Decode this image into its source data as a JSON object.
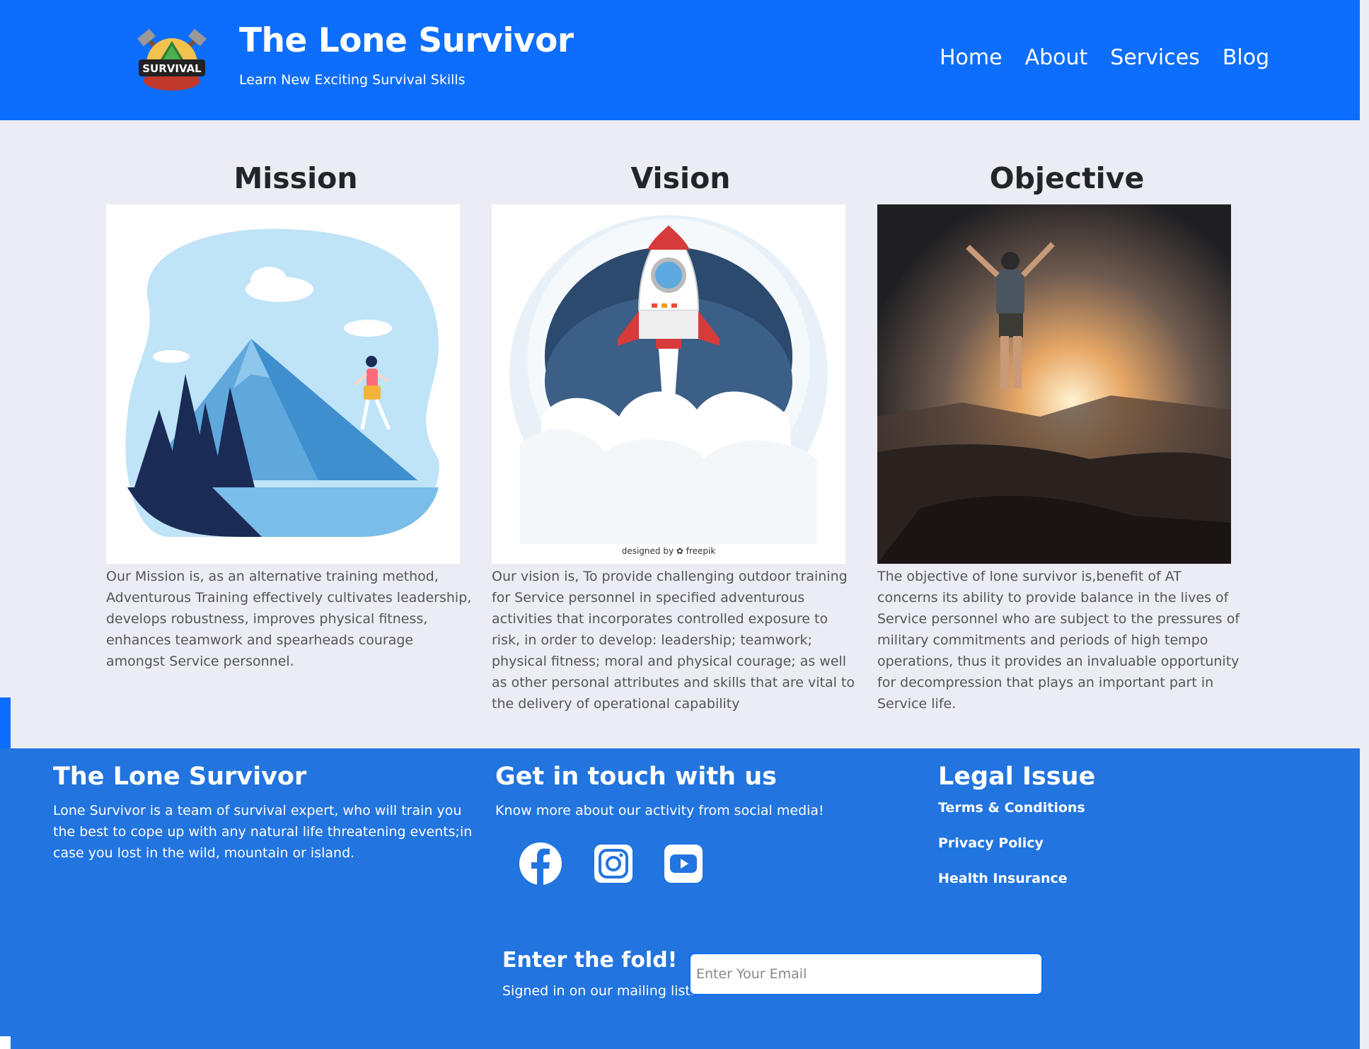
{
  "header": {
    "logo_text": "SURVIVAL",
    "title": "The Lone Survivor",
    "tagline": "Learn New Exciting Survival Skills",
    "nav": [
      "Home",
      "About",
      "Services",
      "Blog"
    ]
  },
  "cards": [
    {
      "title": "Mission",
      "image": "mountain-runner-illustration",
      "text": "Our Mission is, as an alternative training method, Adventurous Training effectively cultivates leadership, develops robustness, improves physical fitness, enhances teamwork and spearheads courage amongst Service personnel."
    },
    {
      "title": "Vision",
      "image": "rocket-launch-illustration",
      "image_credit": "designed by ✿ freepik",
      "text": "Our vision is, To provide challenging outdoor training for Service personnel in specified adventurous activities that incorporates controlled exposure to risk, in order to develop: leadership; teamwork; physical fitness; moral and physical courage; as well as other personal attributes and skills that are vital to the delivery of operational capability"
    },
    {
      "title": "Objective",
      "image": "hiker-on-summit-photo",
      "text": "The objective of lone survivor is,benefit of AT concerns its ability to provide balance in the lives of Service personnel who are subject to the pressures of military commitments and periods of high tempo operations, thus it provides an invaluable opportunity for decompression that plays an important part in Service life."
    }
  ],
  "footer": {
    "about": {
      "title": "The Lone Survivor",
      "text": "Lone Survivor is a team of survival expert, who will train you the best to cope up with any natural life threatening events;in case you lost in the wild, mountain or island."
    },
    "contact": {
      "title": "Get in touch with us",
      "text": "Know more about our activity from social media!",
      "icons": [
        "facebook-icon",
        "instagram-icon",
        "youtube-icon"
      ]
    },
    "legal": {
      "title": "Legal Issue",
      "links": [
        "Terms & Conditions",
        "Privacy Policy",
        "Health Insurance"
      ]
    },
    "newsletter": {
      "title": "Enter the fold!",
      "subtitle": "Signed in on our mailing list.",
      "placeholder": "Enter Your Email"
    }
  },
  "colors": {
    "header_bg": "#0d6efd",
    "footer_bg": "#2274df",
    "page_bg": "#ebecf4"
  }
}
